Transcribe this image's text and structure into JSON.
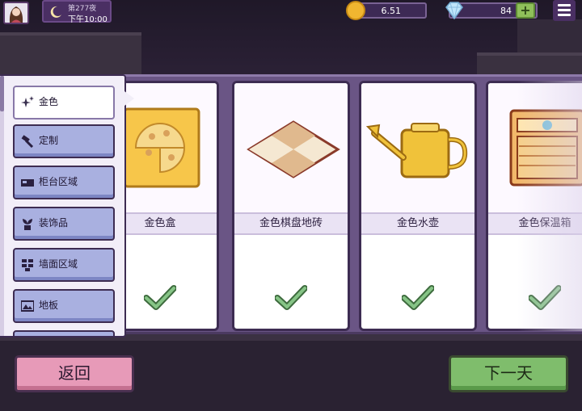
{
  "topbar": {
    "day_label": "第277夜",
    "time_label": "下午10:00",
    "coins": "6.51",
    "gems": "84",
    "plus_label": "+"
  },
  "sidebar": {
    "items": [
      {
        "label": "金色",
        "icon": "sparkle-icon",
        "active": true
      },
      {
        "label": "定制",
        "icon": "hammer-icon",
        "active": false
      },
      {
        "label": "柜台区域",
        "icon": "counter-icon",
        "active": false
      },
      {
        "label": "装饰品",
        "icon": "plant-icon",
        "active": false
      },
      {
        "label": "墙面区域",
        "icon": "wall-icon",
        "active": false
      },
      {
        "label": "地板",
        "icon": "floor-icon",
        "active": false
      }
    ]
  },
  "cards": [
    {
      "name": "金色盒",
      "image": "golden-pizza-box-icon",
      "owned": true
    },
    {
      "name": "金色棋盘地砖",
      "image": "golden-checkered-tile-icon",
      "owned": true
    },
    {
      "name": "金色水壶",
      "image": "golden-watering-can-icon",
      "owned": true
    },
    {
      "name": "金色保温箱",
      "image": "golden-warmer-cabinet-icon",
      "owned": true
    }
  ],
  "buttons": {
    "back": "返回",
    "next_day": "下一天"
  },
  "colors": {
    "panel": "#6a5585",
    "check": "#6aa86a",
    "gold": "#f0c23a",
    "back_button": "#e79ab8",
    "next_button": "#7fbd6c"
  }
}
